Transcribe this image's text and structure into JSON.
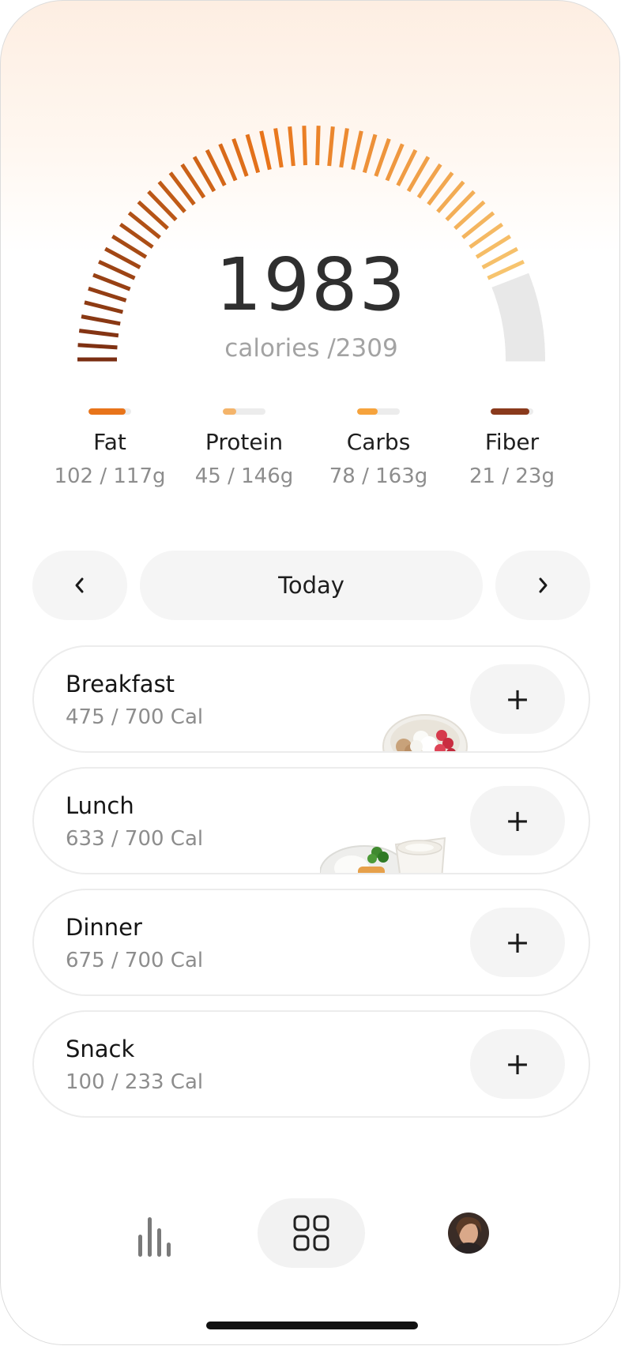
{
  "summary": {
    "calories_eaten": "1983",
    "calories_label": "calories /2309",
    "calories_goal": 2309,
    "progress_fraction": 0.859
  },
  "colors": {
    "fat": "#e8741a",
    "protein": "#f4b46a",
    "carbs": "#f6a33c",
    "fiber": "#8a3a1c",
    "track": "#ececec",
    "gauge_start": "#7a2e12",
    "gauge_mid": "#e8741a",
    "gauge_end": "#f7c46e",
    "gauge_remaining": "#e8e8e8"
  },
  "macros": [
    {
      "name": "Fat",
      "value": "102 / 117g",
      "fraction": 0.87,
      "color": "#e8741a"
    },
    {
      "name": "Protein",
      "value": "45 / 146g",
      "fraction": 0.31,
      "color": "#f4b46a"
    },
    {
      "name": "Carbs",
      "value": "78 / 163g",
      "fraction": 0.48,
      "color": "#f6a33c"
    },
    {
      "name": "Fiber",
      "value": "21 / 23g",
      "fraction": 0.91,
      "color": "#8a3a1c"
    }
  ],
  "day_nav": {
    "prev_icon": "chevron-left-icon",
    "prev_glyph": "‹",
    "label": "Today",
    "next_icon": "chevron-right-icon",
    "next_glyph": "›"
  },
  "meals": [
    {
      "title": "Breakfast",
      "calories": "475 / 700 Cal",
      "add": "+",
      "image": "oatmeal-berries-bowl"
    },
    {
      "title": "Lunch",
      "calories": "633 / 700 Cal",
      "add": "+",
      "image": "rice-broccoli-yogurt"
    },
    {
      "title": "Dinner",
      "calories": "675 / 700 Cal",
      "add": "+"
    },
    {
      "title": "Snack",
      "calories": "100 / 233 Cal",
      "add": "+"
    }
  ],
  "tabbar": {
    "stats_icon": "bar-chart-icon",
    "home_icon": "grid-icon",
    "profile_icon": "avatar"
  }
}
